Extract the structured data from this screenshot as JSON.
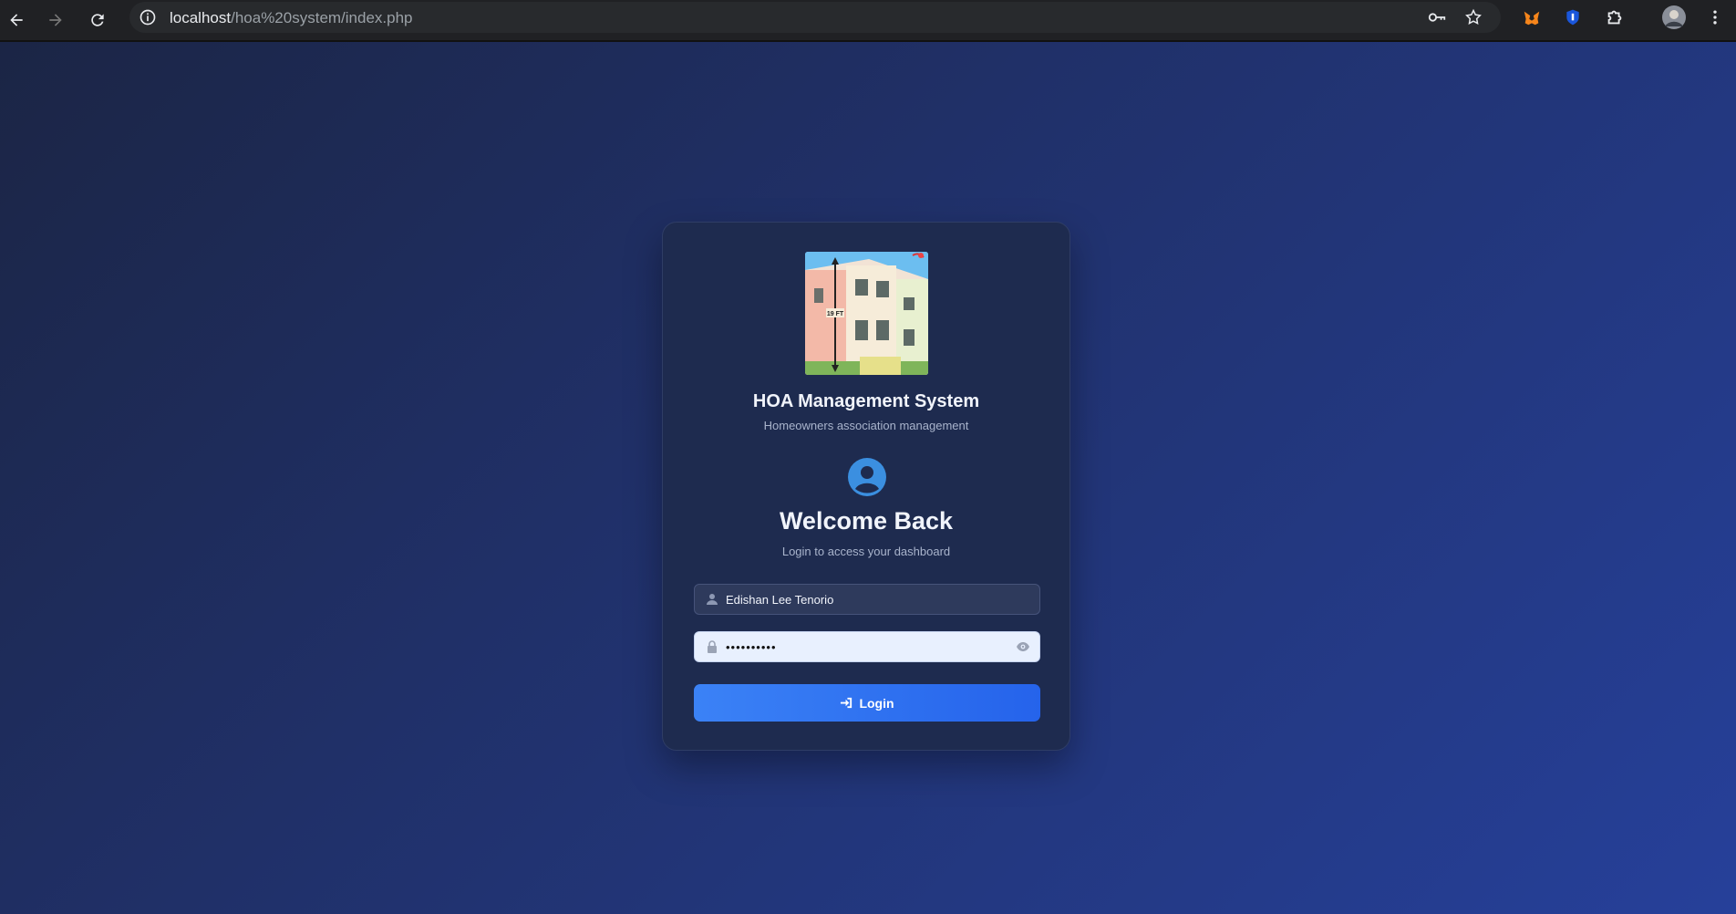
{
  "browser": {
    "url_host": "localhost",
    "url_path": "/hoa%20system/index.php"
  },
  "header": {
    "title": "HOA Management System",
    "subtitle": "Homeowners association management"
  },
  "logo": {
    "height_label": "19 FT"
  },
  "login": {
    "heading": "Welcome Back",
    "subheading": "Login to access your dashboard",
    "username_value": "Edishan Lee Tenorio",
    "password_value": "••••••••••",
    "button_label": "Login"
  },
  "colors": {
    "accent": "#3b82f6",
    "card_bg": "#1e2b4f",
    "page_bg": "#203068"
  }
}
